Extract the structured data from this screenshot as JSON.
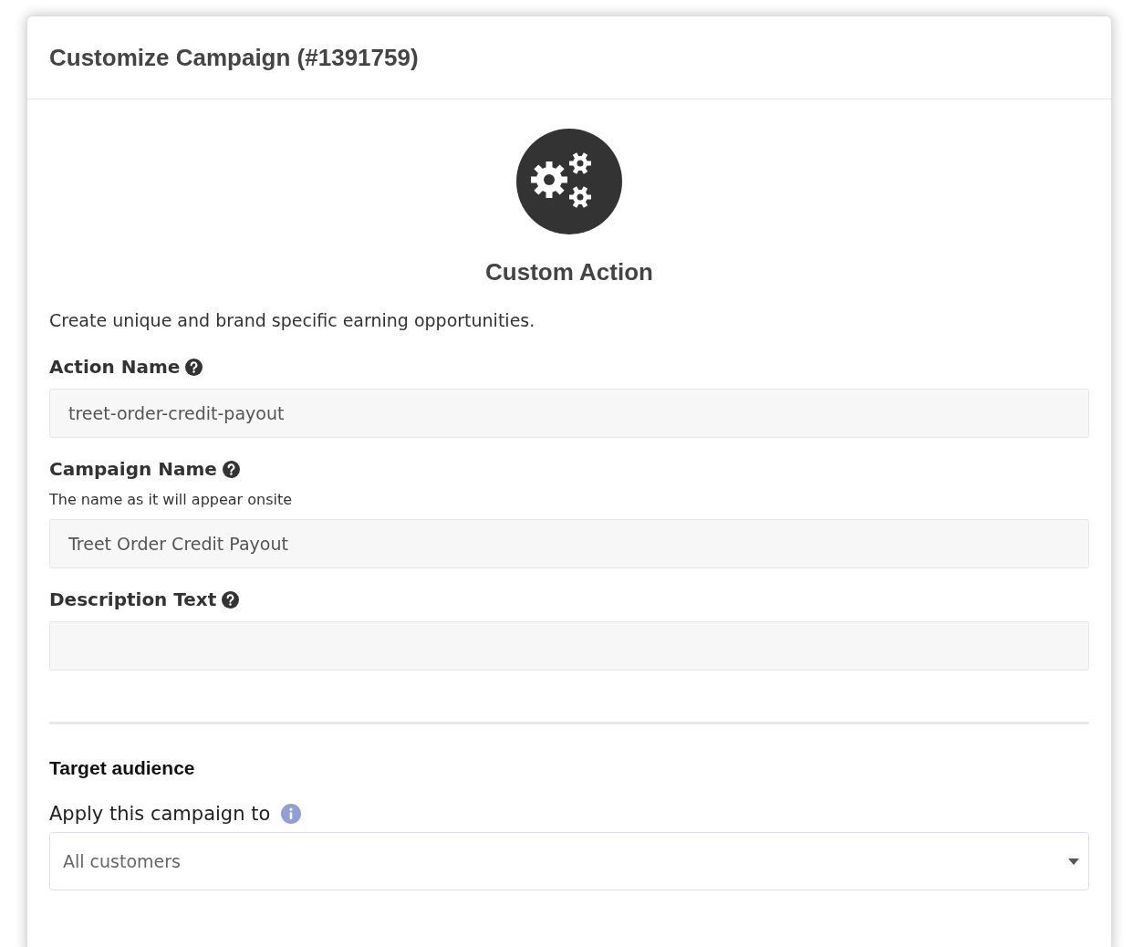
{
  "window": {
    "title": "Customize Campaign (#1391759)"
  },
  "action": {
    "title": "Custom Action",
    "description": "Create unique and brand specific earning opportunities."
  },
  "fields": [
    {
      "label": "Action Name",
      "value": "treet-order-credit-payout"
    },
    {
      "label": "Campaign Name",
      "hint": "The name as it will appear onsite",
      "value": "Treet Order Credit Payout"
    },
    {
      "label": "Description Text"
    }
  ],
  "target": {
    "heading": "Target audience",
    "label": "Apply this campaign to",
    "select": {
      "value": "All customers"
    }
  }
}
